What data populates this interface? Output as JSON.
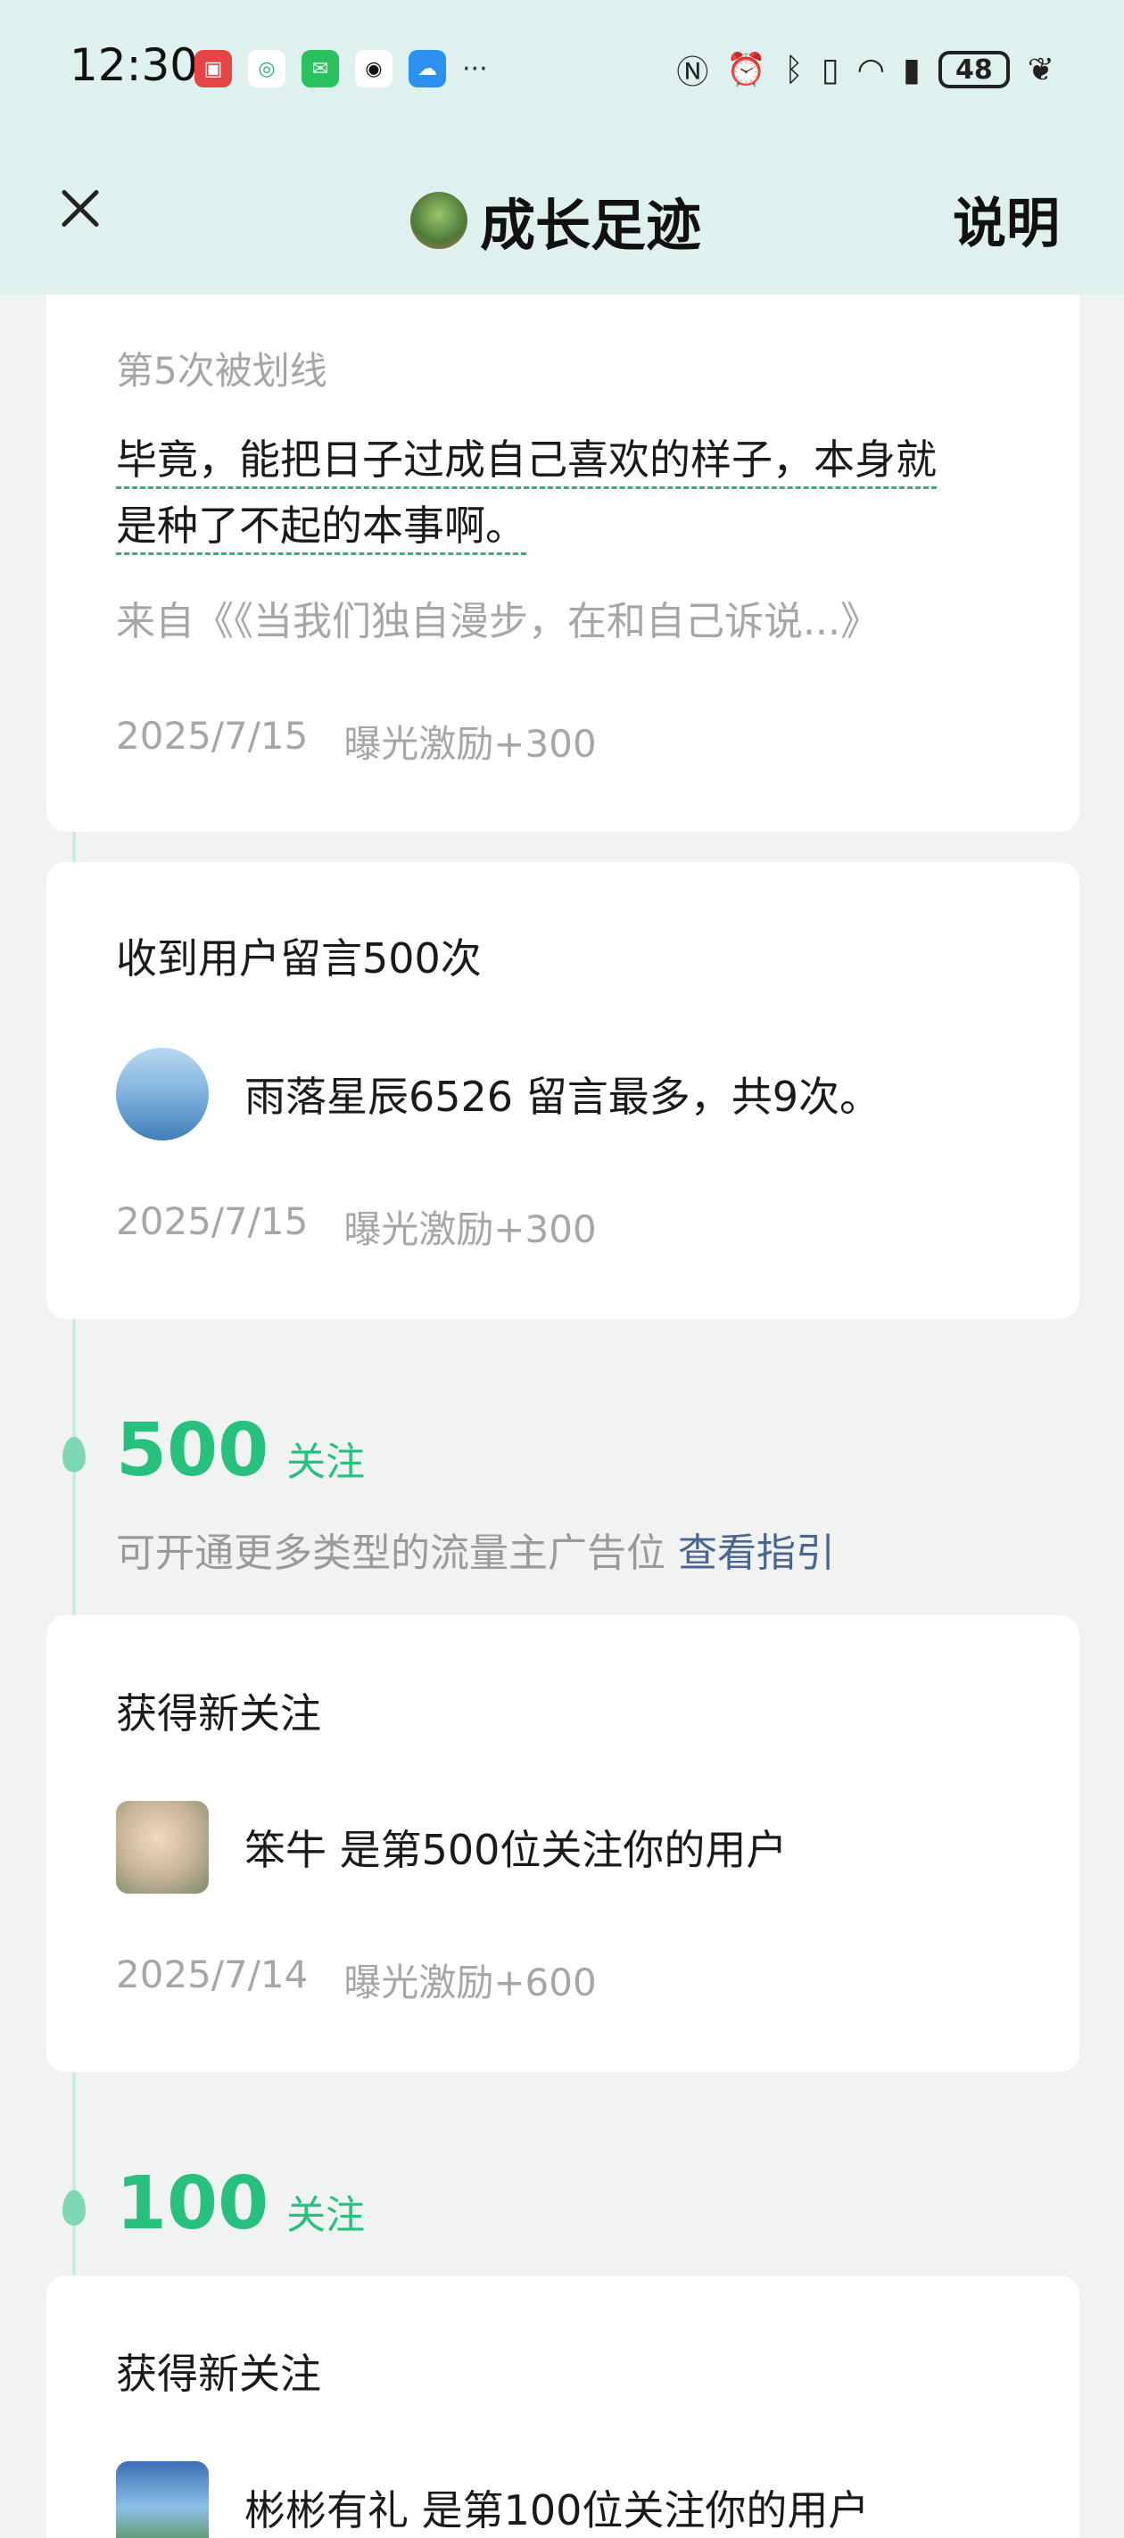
{
  "status_bar": {
    "time": "12:30",
    "app_icons": [
      "huawei-store-icon",
      "green-app-icon",
      "wechat-icon",
      "qq-icon",
      "cloud-icon"
    ],
    "more": "···",
    "battery": "48"
  },
  "nav": {
    "title": "成长足迹",
    "help_label": "说明"
  },
  "entries": [
    {
      "type": "underline",
      "sub": "第5次被划线",
      "quote_line1": "毕竟，能把日子过成自己喜欢的样子，本身就",
      "quote_line2": "是种了不起的本事啊。",
      "source": "来自《《当我们独自漫步，在和自己诉说...》",
      "date": "2025/7/15",
      "reward": "曝光激励+300"
    },
    {
      "type": "comments",
      "title": "收到用户留言500次",
      "user_text": "雨落星辰6526 留言最多，共9次。",
      "date": "2025/7/15",
      "reward": "曝光激励+300"
    }
  ],
  "milestones": [
    {
      "number": "500",
      "label": "关注",
      "desc": "可开通更多类型的流量主广告位",
      "link": "查看指引",
      "card": {
        "title": "获得新关注",
        "user_text": "笨牛 是第500位关注你的用户",
        "date": "2025/7/14",
        "reward": "曝光激励+600"
      }
    },
    {
      "number": "100",
      "label": "关注",
      "card": {
        "title": "获得新关注",
        "user_text": "彬彬有礼 是第100位关注你的用户"
      }
    }
  ],
  "colors": {
    "accent": "#27c07c",
    "header_bg": "#dff1ee",
    "link": "#4a6690"
  }
}
